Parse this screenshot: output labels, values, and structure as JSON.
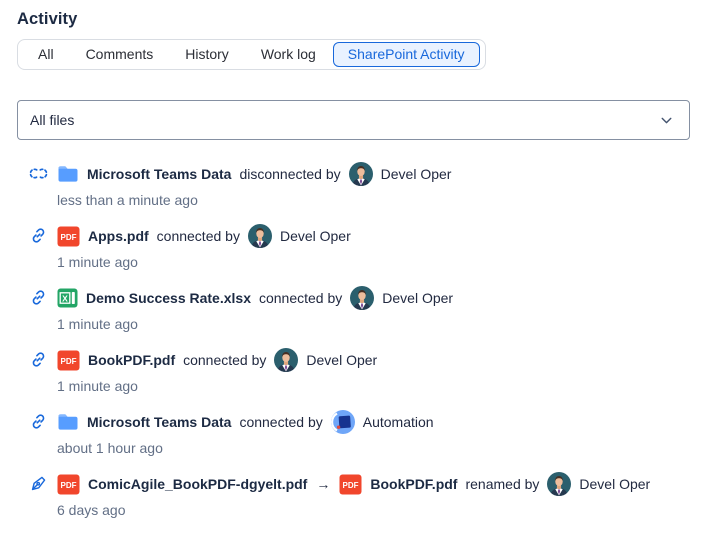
{
  "header": {
    "title": "Activity"
  },
  "tabs": [
    {
      "label": "All",
      "selected": false
    },
    {
      "label": "Comments",
      "selected": false
    },
    {
      "label": "History",
      "selected": false
    },
    {
      "label": "Work log",
      "selected": false
    },
    {
      "label": "SharePoint Activity",
      "selected": true
    }
  ],
  "filter": {
    "value": "All files",
    "chevron_icon": "chevron-down-icon"
  },
  "icon_labels": {
    "pdf_badge": "PDF",
    "excel_badge": "X"
  },
  "colors": {
    "accent_blue": "#1868DB",
    "selected_tab_bg": "#E9F2FF",
    "folder_blue": "#579DFF",
    "folder_tab_blue": "#85B8FF",
    "pdf_red": "#F1462C",
    "excel_green": "#23A566",
    "text_dark": "#1c2a43",
    "text_muted": "#626F86",
    "dropdown_border": "#8590A2"
  },
  "activity": [
    {
      "action_icon": "disconnect-icon",
      "files": [
        {
          "type": "folder",
          "name": "Microsoft Teams Data"
        }
      ],
      "arrow": "",
      "action_text": "disconnected by",
      "actor": {
        "name": "Devel Oper",
        "avatar": "person"
      },
      "timestamp": "less than a minute ago"
    },
    {
      "action_icon": "link-icon",
      "files": [
        {
          "type": "pdf",
          "name": "Apps.pdf"
        }
      ],
      "arrow": "",
      "action_text": "connected by",
      "actor": {
        "name": "Devel Oper",
        "avatar": "person"
      },
      "timestamp": "1 minute ago"
    },
    {
      "action_icon": "link-icon",
      "files": [
        {
          "type": "excel",
          "name": "Demo Success Rate.xlsx"
        }
      ],
      "arrow": "",
      "action_text": "connected by",
      "actor": {
        "name": "Devel Oper",
        "avatar": "person"
      },
      "timestamp": "1 minute ago"
    },
    {
      "action_icon": "link-icon",
      "files": [
        {
          "type": "pdf",
          "name": "BookPDF.pdf"
        }
      ],
      "arrow": "",
      "action_text": "connected by",
      "actor": {
        "name": "Devel Oper",
        "avatar": "person"
      },
      "timestamp": "1 minute ago"
    },
    {
      "action_icon": "link-icon",
      "files": [
        {
          "type": "folder",
          "name": "Microsoft Teams Data"
        }
      ],
      "arrow": "",
      "action_text": "connected by",
      "actor": {
        "name": "Automation",
        "avatar": "automation"
      },
      "timestamp": "about 1 hour ago"
    },
    {
      "action_icon": "rename-icon",
      "files": [
        {
          "type": "pdf",
          "name": "ComicAgile_BookPDF-dgyelt.pdf"
        },
        {
          "type": "pdf",
          "name": "BookPDF.pdf"
        }
      ],
      "arrow": "→",
      "action_text": "renamed by",
      "actor": {
        "name": "Devel Oper",
        "avatar": "person"
      },
      "timestamp": "6 days ago"
    }
  ]
}
